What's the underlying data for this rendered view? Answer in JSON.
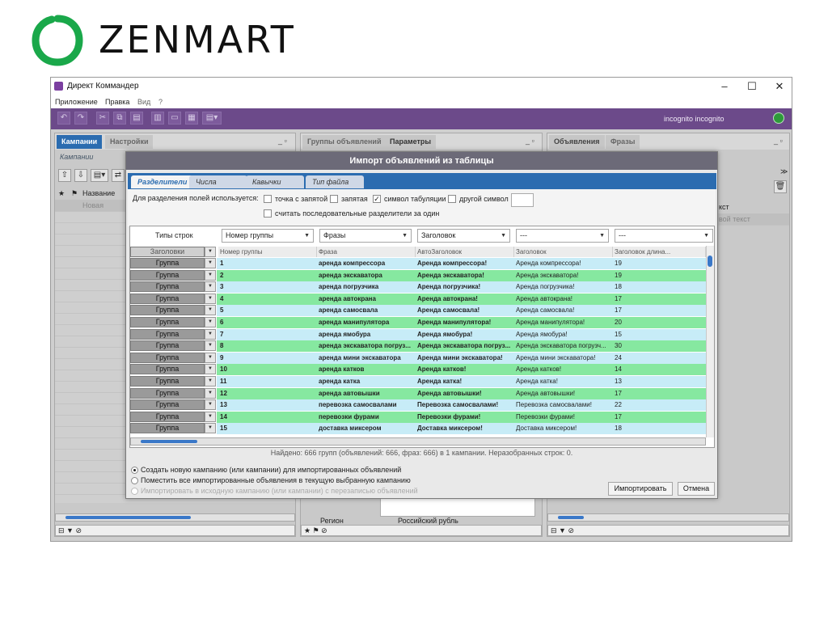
{
  "logo": {
    "text": "ZENMART"
  },
  "window": {
    "title": "Директ Коммандер",
    "minimize": "–",
    "maximize": "☐",
    "close": "✕"
  },
  "menu": [
    "Приложение",
    "Правка",
    "Вид",
    "?"
  ],
  "toolbar": {
    "user": "incognito incognito"
  },
  "left_panel": {
    "tab_active": "Кампании",
    "tab_inactive": "Настройки",
    "subtitle": "Кампании",
    "col_name": "Название",
    "new_row": "Новая"
  },
  "mid_panel": {
    "tab1": "Группы объявлений",
    "tab2": "Параметры",
    "bottom_label": "Регион",
    "bottom_value": "Российский рубль"
  },
  "right_panel": {
    "tab_active": "Объявления",
    "tab_inactive": "Фразы",
    "col_text": "кст",
    "row_text": "вой текст"
  },
  "dialog": {
    "title": "Импорт объявлений из таблицы",
    "tabs": [
      "Разделители",
      "Числа",
      "Кавычки",
      "Тип файла"
    ],
    "sep_label": "Для разделения полей используется:",
    "opt_dot_comma": "точка с запятой",
    "opt_comma": "запятая",
    "opt_tab": "символ табуляции",
    "opt_other": "другой символ",
    "opt_consecutive": "считать последовательные разделители за один",
    "row_types_label": "Типы строк",
    "col_selects": [
      "Номер группы",
      "Фразы",
      "Заголовок",
      "---",
      "---"
    ],
    "row_type_header": "Заголовки",
    "headers": [
      "Номер группы",
      "Фраза",
      "АвтоЗаголовок",
      "Заголовок",
      "Заголовок длина..."
    ],
    "group_label": "Группа",
    "rows": [
      [
        "1",
        "аренда компрессора",
        "Аренда компрессора!",
        "Аренда компрессора!",
        "19"
      ],
      [
        "2",
        "аренда экскаватора",
        "Аренда экскаватора!",
        "Аренда экскаватора!",
        "19"
      ],
      [
        "3",
        "аренда погрузчика",
        "Аренда погрузчика!",
        "Аренда погрузчика!",
        "18"
      ],
      [
        "4",
        "аренда автокрана",
        "Аренда автокрана!",
        "Аренда автокрана!",
        "17"
      ],
      [
        "5",
        "аренда самосвала",
        "Аренда самосвала!",
        "Аренда самосвала!",
        "17"
      ],
      [
        "6",
        "аренда манипулятора",
        "Аренда манипулятора!",
        "Аренда манипулятора!",
        "20"
      ],
      [
        "7",
        "аренда ямобура",
        "Аренда ямобура!",
        "Аренда ямобура!",
        "15"
      ],
      [
        "8",
        "аренда экскаватора погруз...",
        "Аренда экскаватора погруз...",
        "Аренда экскаватора погрузч...",
        "30"
      ],
      [
        "9",
        "аренда мини экскаватора",
        "Аренда мини экскаватора!",
        "Аренда мини экскаватора!",
        "24"
      ],
      [
        "10",
        "аренда катков",
        "Аренда катков!",
        "Аренда катков!",
        "14"
      ],
      [
        "11",
        "аренда катка",
        "Аренда катка!",
        "Аренда катка!",
        "13"
      ],
      [
        "12",
        "аренда автовышки",
        "Аренда автовышки!",
        "Аренда автовышки!",
        "17"
      ],
      [
        "13",
        "перевозка самосвалами",
        "Перевозка самосвалами!",
        "Перевозка самосвалами!",
        "22"
      ],
      [
        "14",
        "перевозки фурами",
        "Перевозки фурами!",
        "Перевозки фурами!",
        "17"
      ],
      [
        "15",
        "доставка миксером",
        "Доставка миксером!",
        "Доставка миксером!",
        "18"
      ]
    ],
    "status": "Найдено: 666 групп (объявлений: 666, фраз: 666) в 1 кампании. Неразобранных строк: 0.",
    "radio1": "Создать новую кампанию (или кампании) для импортированных объявлений",
    "radio2": "Поместить все импортированные объявления в текущую выбранную кампанию",
    "radio3": "Импортировать в исходную кампанию (или кампании) с перезаписью объявлений",
    "import_button": "Импортировать",
    "cancel_button": "Отмена"
  },
  "colors": {
    "row_green": "#86e8a0",
    "row_blue": "#c7ecf7",
    "accent": "#2b6cb0",
    "toolbar": "#6c4a8a"
  }
}
